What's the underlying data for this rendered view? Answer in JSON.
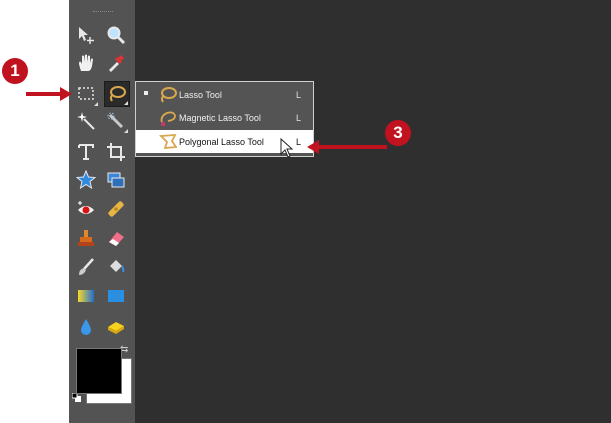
{
  "flyout_menu": {
    "items": [
      {
        "label": "Lasso Tool",
        "shortcut": "L",
        "icon": "lasso-icon",
        "current": true
      },
      {
        "label": "Magnetic Lasso Tool",
        "shortcut": "L",
        "icon": "magnetic-lasso-icon"
      },
      {
        "label": "Polygonal Lasso Tool",
        "shortcut": "L",
        "icon": "polygonal-lasso-icon",
        "highlighted": true
      }
    ]
  },
  "callouts": [
    {
      "label": "1",
      "target": "lasso-tool-button"
    },
    {
      "label": "3",
      "target": "polygonal-lasso-tool-item"
    }
  ],
  "toolbar_tools": [
    "move-tool",
    "zoom-tool",
    "hand-tool",
    "eyedropper-tool",
    "marquee-tool",
    "lasso-tool",
    "magic-wand-tool",
    "quick-selection-tool",
    "type-tool",
    "crop-tool",
    "shape-tool",
    "path-selection-tool",
    "red-eye-tool",
    "healing-brush-tool",
    "clone-stamp-tool",
    "eraser-tool",
    "brush-tool",
    "paint-bucket-tool",
    "gradient-tool",
    "rectangle-tool",
    "blur-tool",
    "sponge-tool"
  ],
  "colors": {
    "foreground": "#000000",
    "background": "#ffffff",
    "callout": "#c1121f",
    "panel": "#535353",
    "canvas": "#2f2f2f"
  }
}
